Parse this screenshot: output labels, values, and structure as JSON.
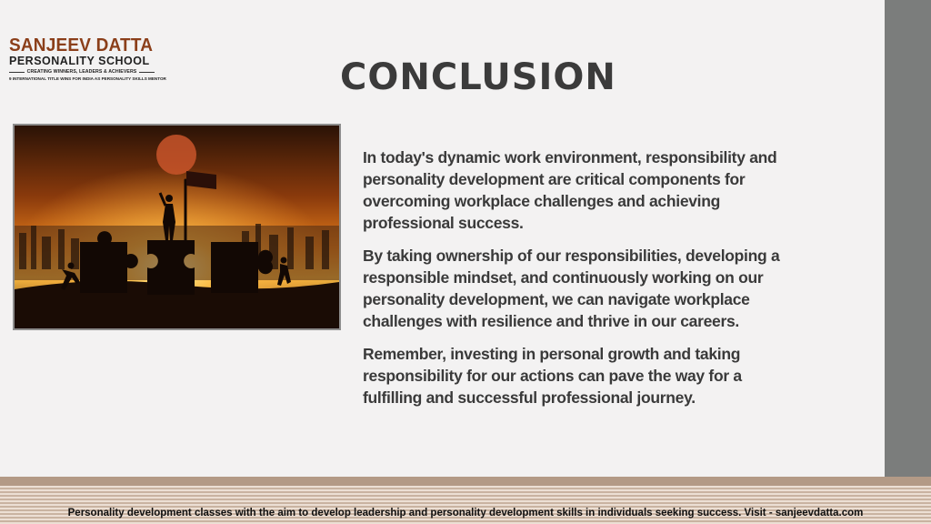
{
  "logo": {
    "line1": "SANJEEV DATTA",
    "line2": "PERSONALITY SCHOOL",
    "line3": "CREATING WINNERS, LEADERS & ACHIEVERS",
    "line4": "9 INTERNATIONAL TITLE WINS FOR INDIA AS PERSONALITY SKILLS MENTOR"
  },
  "title": "CONCLUSION",
  "paragraphs": [
    "In today's dynamic work environment, responsibility and personality development are critical components for overcoming workplace challenges and achieving professional success.",
    "By taking ownership of our responsibilities, developing a responsible mindset, and continuously working on our personality development, we can navigate workplace challenges with resilience and thrive in our careers.",
    "Remember, investing in personal growth and taking responsibility for our actions can pave the way for a fulfilling and successful professional journey."
  ],
  "footer": "Personality development classes with the aim to develop leadership and personality development skills in individuals seeking success. Visit - sanjeevdatta.com",
  "colors": {
    "background": "#f3f2f2",
    "right_bar": "#7b7d7c",
    "title": "#3b3b3b",
    "logo_brand": "#8b3f1a"
  }
}
